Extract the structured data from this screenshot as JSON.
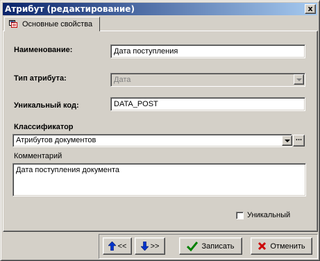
{
  "window": {
    "title": "Атрибут (редактирование)",
    "close_label": "x"
  },
  "tabs": [
    {
      "label": "Основные свойства",
      "icon": "properties-icon"
    }
  ],
  "form": {
    "name_label": "Наименование:",
    "name_value": "Дата поступления",
    "type_label": "Тип атрибута:",
    "type_value": "Дата",
    "code_label": "Уникальный код:",
    "code_value": "DATA_POST",
    "classifier_label": "Классификатор",
    "classifier_value": "Атрибутов документов",
    "classifier_more": "...",
    "comment_label": "Комментарий",
    "comment_value": "Дата поступления документа",
    "unique_label": "Уникальный",
    "unique_checked": false
  },
  "buttons": {
    "prev_label": "<<",
    "next_label": ">>",
    "save_label": "Записать",
    "cancel_label": "Отменить"
  },
  "colors": {
    "title_start": "#0a246a",
    "title_end": "#a6caf0",
    "face": "#d4d0c8",
    "arrow_blue": "#0033cc",
    "check_green": "#008000",
    "cancel_red": "#cc0000"
  }
}
